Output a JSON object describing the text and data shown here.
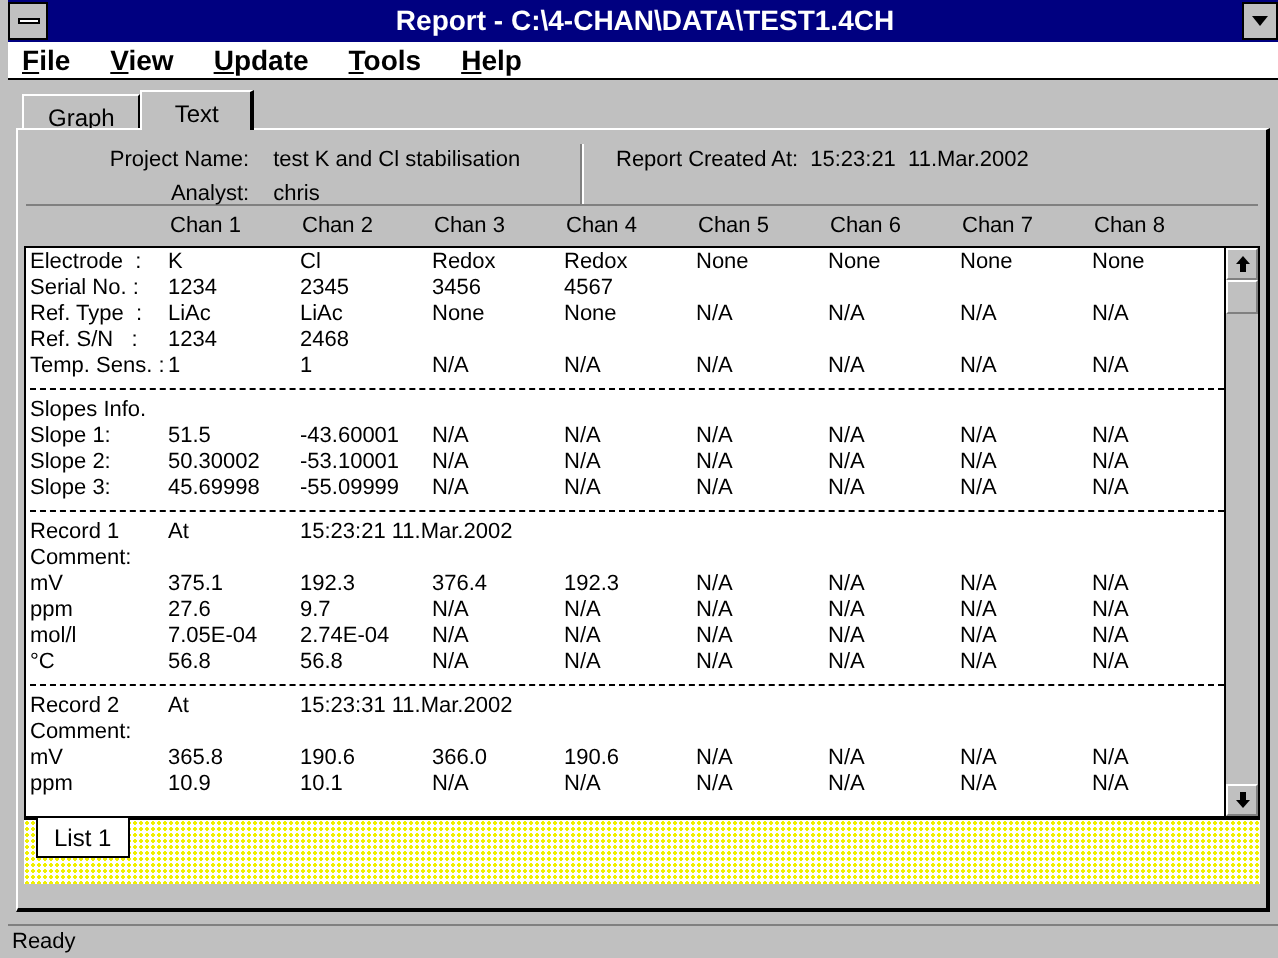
{
  "window": {
    "title": "Report - C:\\4-CHAN\\DATA\\TEST1.4CH"
  },
  "menu": [
    {
      "label": "File"
    },
    {
      "label": "View"
    },
    {
      "label": "Update"
    },
    {
      "label": "Tools"
    },
    {
      "label": "Help"
    }
  ],
  "tabs": [
    {
      "label": "Graph",
      "selected": false
    },
    {
      "label": "Text",
      "selected": true
    }
  ],
  "header": {
    "fields": [
      {
        "label": "Project Name:",
        "value": "test K and Cl stabilisation"
      },
      {
        "label": "Analyst:",
        "value": "chris"
      }
    ],
    "created": {
      "label": "Report Created At:",
      "value": "15:23:21  11.Mar.2002"
    }
  },
  "columns": [
    "Chan 1",
    "Chan 2",
    "Chan 3",
    "Chan 4",
    "Chan 5",
    "Chan 6",
    "Chan 7",
    "Chan 8"
  ],
  "sections": [
    {
      "rows": [
        {
          "label": "Electrode  :",
          "cells": [
            "K",
            "Cl",
            "Redox",
            "Redox",
            "None",
            "None",
            "None",
            "None"
          ]
        },
        {
          "label": "Serial No. :",
          "cells": [
            "1234",
            "2345",
            "3456",
            "4567"
          ]
        },
        {
          "label": "Ref. Type  :",
          "cells": [
            "LiAc",
            "LiAc",
            "None",
            "None",
            "N/A",
            "N/A",
            "N/A",
            "N/A"
          ]
        },
        {
          "label": "Ref. S/N   :",
          "cells": [
            "1234",
            "2468"
          ]
        },
        {
          "label": "Temp. Sens. :",
          "cells": [
            "1",
            "1",
            "N/A",
            "N/A",
            "N/A",
            "N/A",
            "N/A",
            "N/A"
          ]
        }
      ]
    },
    {
      "rows": [
        {
          "label": "Slopes Info.",
          "cells": []
        },
        {
          "label": "Slope 1:",
          "cells": [
            "51.5",
            "-43.60001",
            "N/A",
            "N/A",
            "N/A",
            "N/A",
            "N/A",
            "N/A"
          ]
        },
        {
          "label": "Slope 2:",
          "cells": [
            "50.30002",
            "-53.10001",
            "N/A",
            "N/A",
            "N/A",
            "N/A",
            "N/A",
            "N/A"
          ]
        },
        {
          "label": "Slope 3:",
          "cells": [
            "45.69998",
            "-55.09999",
            "N/A",
            "N/A",
            "N/A",
            "N/A",
            "N/A",
            "N/A"
          ]
        }
      ]
    },
    {
      "rows": [
        {
          "label": "Record 1",
          "cells": [
            "At",
            "15:23:21 11.Mar.2002"
          ]
        },
        {
          "label": "Comment:",
          "cells": []
        },
        {
          "label": "mV",
          "cells": [
            "375.1",
            "192.3",
            "376.4",
            "192.3",
            "N/A",
            "N/A",
            "N/A",
            "N/A"
          ]
        },
        {
          "label": "ppm",
          "cells": [
            "27.6",
            "9.7",
            "N/A",
            "N/A",
            "N/A",
            "N/A",
            "N/A",
            "N/A"
          ]
        },
        {
          "label": "mol/l",
          "cells": [
            "7.05E-04",
            "2.74E-04",
            "N/A",
            "N/A",
            "N/A",
            "N/A",
            "N/A",
            "N/A"
          ]
        },
        {
          "label": "°C",
          "cells": [
            "56.8",
            "56.8",
            "N/A",
            "N/A",
            "N/A",
            "N/A",
            "N/A",
            "N/A"
          ]
        }
      ]
    },
    {
      "rows": [
        {
          "label": "Record 2",
          "cells": [
            "At",
            "15:23:31 11.Mar.2002"
          ]
        },
        {
          "label": "Comment:",
          "cells": []
        },
        {
          "label": "mV",
          "cells": [
            "365.8",
            "190.6",
            "366.0",
            "190.6",
            "N/A",
            "N/A",
            "N/A",
            "N/A"
          ]
        },
        {
          "label": "ppm",
          "cells": [
            "10.9",
            "10.1",
            "N/A",
            "N/A",
            "N/A",
            "N/A",
            "N/A",
            "N/A"
          ]
        }
      ]
    }
  ],
  "sheet_tabs": [
    {
      "label": "List 1",
      "selected": true
    }
  ],
  "status_bar": "Ready"
}
